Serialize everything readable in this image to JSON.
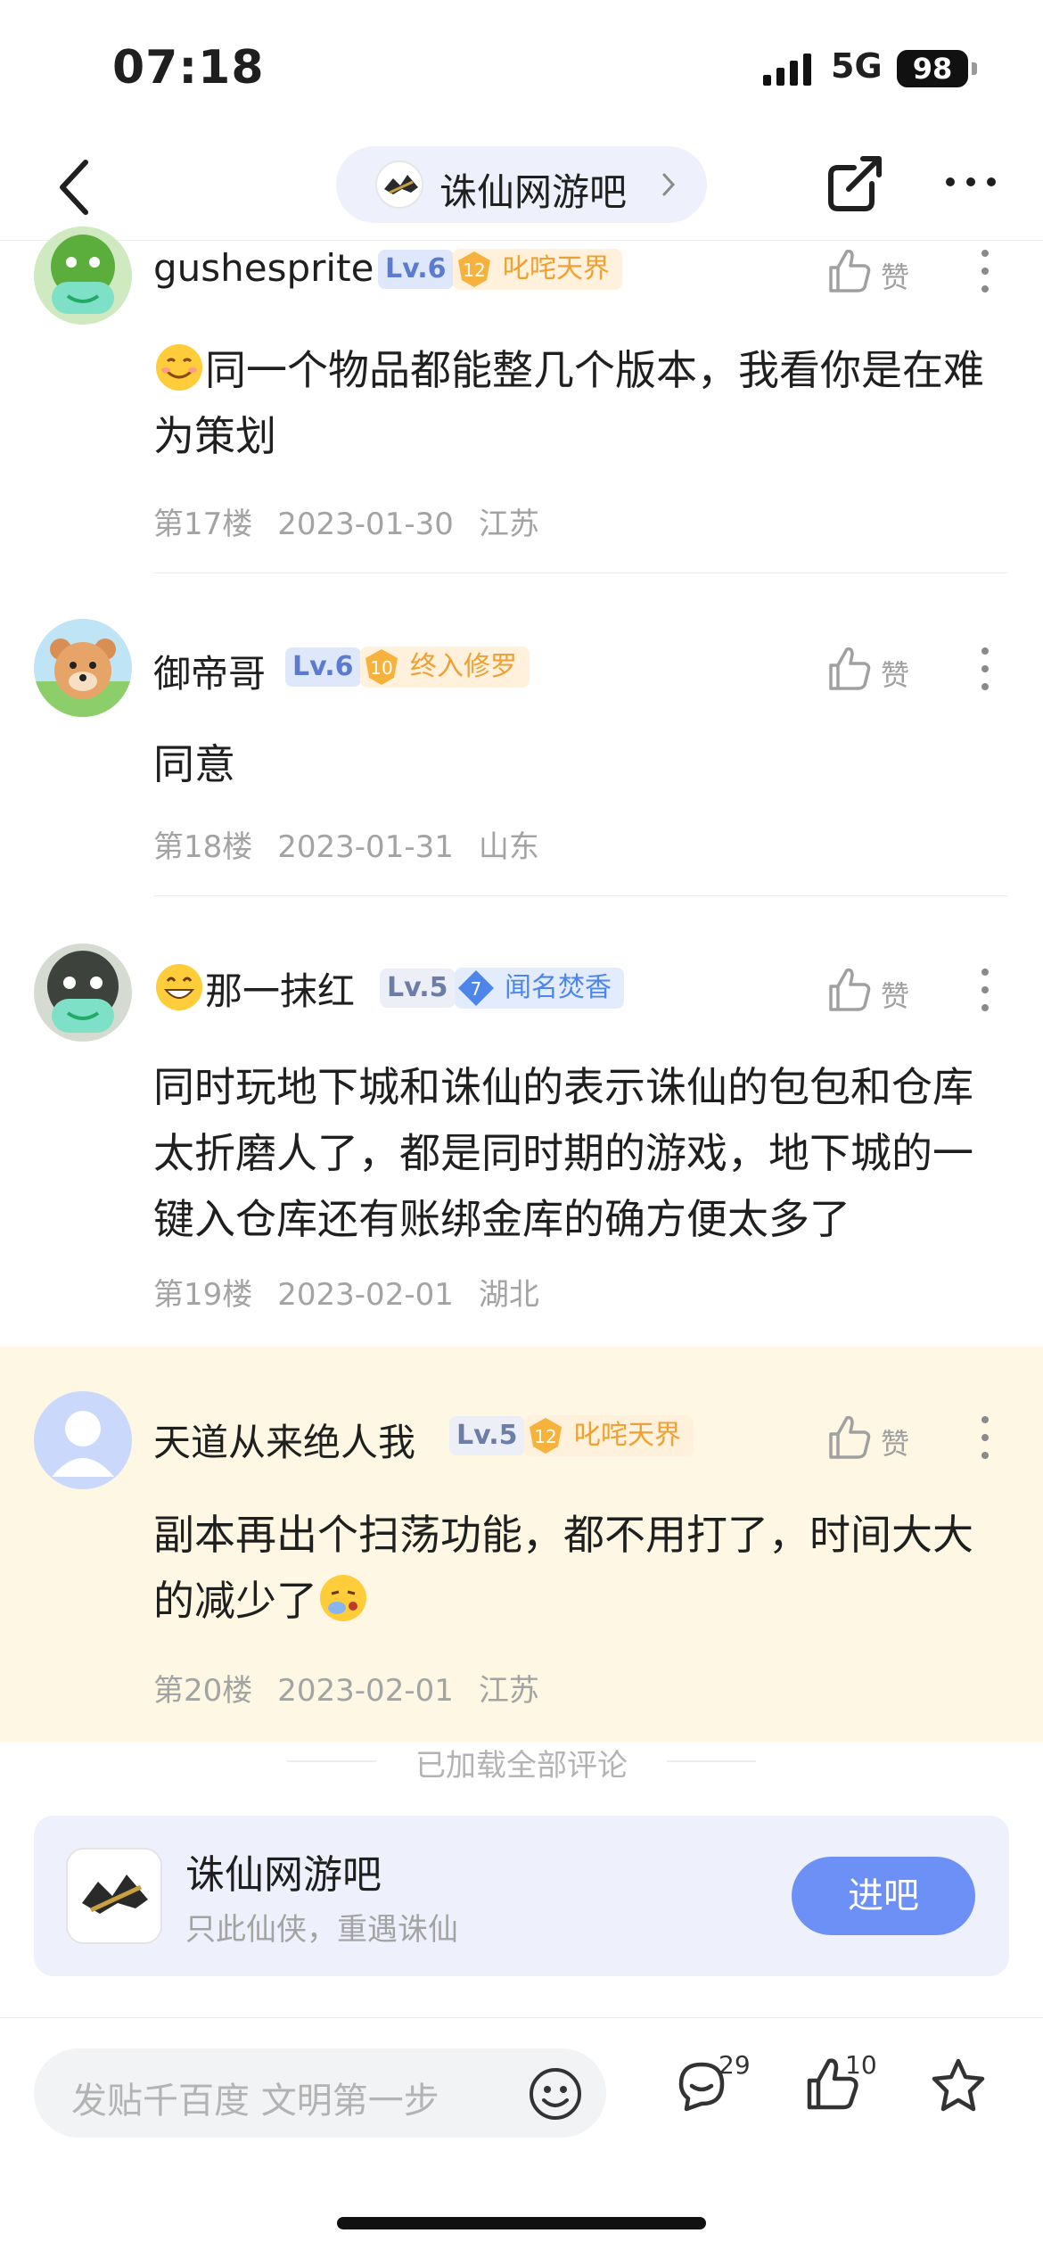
{
  "status_bar": {
    "time": "07:18",
    "network": "5G",
    "battery": "98"
  },
  "nav": {
    "forum_name": "诛仙网游吧",
    "forum_logo_text": "诛仙"
  },
  "posts": [
    {
      "username": "gushesprite",
      "level": "Lv.6",
      "badge_num": "12",
      "badge_title": "叱咤天界",
      "like_label": "赞",
      "content": "同一个物品都能整几个版本，我看你是在难为策划",
      "floor": "第17楼",
      "date": "2023-01-30",
      "region": "江苏"
    },
    {
      "username": "御帝哥",
      "level": "Lv.6",
      "badge_num": "10",
      "badge_title": "终入修罗",
      "like_label": "赞",
      "content": "同意",
      "floor": "第18楼",
      "date": "2023-01-31",
      "region": "山东"
    },
    {
      "username": "那一抹红",
      "level": "Lv.5",
      "badge_num": "7",
      "badge_title": "闻名焚香",
      "like_label": "赞",
      "content": "同时玩地下城和诛仙的表示诛仙的包包和仓库太折磨人了，都是同时期的游戏，地下城的一键入仓库还有账绑金库的确方便太多了",
      "floor": "第19楼",
      "date": "2023-02-01",
      "region": "湖北"
    },
    {
      "username": "天道从来绝人我",
      "level": "Lv.5",
      "badge_num": "12",
      "badge_title": "叱咤天界",
      "like_label": "赞",
      "content": "副本再出个扫荡功能，都不用打了，时间大大的减少了",
      "floor": "第20楼",
      "date": "2023-02-01",
      "region": "江苏"
    }
  ],
  "loaded_all": "已加载全部评论",
  "forum_card": {
    "name": "诛仙网游吧",
    "slogan": "只此仙侠，重遇诛仙",
    "enter_label": "进吧",
    "logo_text": "诛仙"
  },
  "bottom_bar": {
    "placeholder": "发贴千百度 文明第一步",
    "comment_count": "29",
    "like_count": "10"
  },
  "colors": {
    "accent": "#6d90f6",
    "highlight_bg": "#fdf7e3",
    "gold_badge": "#f0a030",
    "blue_badge": "#4d86e8"
  }
}
